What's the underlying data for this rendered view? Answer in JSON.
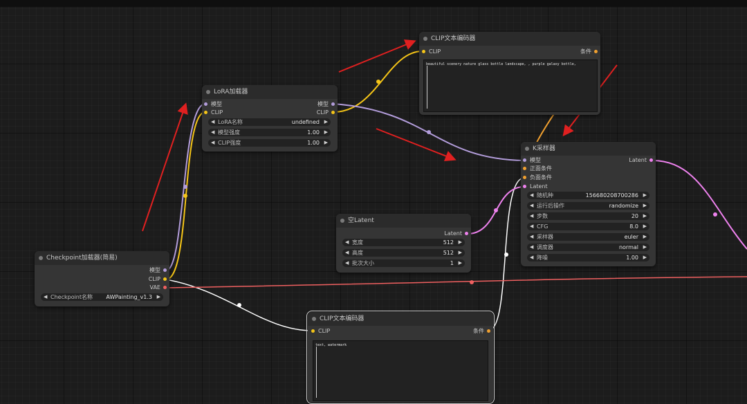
{
  "colors": {
    "model": "#b39ddb",
    "clip": "#f5c518",
    "vae": "#f06060",
    "cond": "#f0a030",
    "latent": "#ee82ee",
    "white": "#ffffff",
    "arrow": "#e02020"
  },
  "nodes": {
    "clip_top": {
      "title": "CLIP文本编码器",
      "in_clip": "CLIP",
      "out_cond": "条件",
      "text": "beautiful scenery nature glass bottle landscape, , purple galaxy bottle,"
    },
    "lora": {
      "title": "LoRA加载器",
      "in_model": "模型",
      "in_clip": "CLIP",
      "out_model": "模型",
      "out_clip": "CLIP",
      "widgets": [
        {
          "label": "LoRA名称",
          "value": "undefined"
        },
        {
          "label": "模型强度",
          "value": "1.00"
        },
        {
          "label": "CLIP强度",
          "value": "1.00"
        }
      ]
    },
    "ksampler": {
      "title": "K采样器",
      "in_model": "模型",
      "in_pos": "正面条件",
      "in_neg": "负面条件",
      "in_latent": "Latent",
      "out_latent": "Latent",
      "widgets": [
        {
          "label": "随机种",
          "value": "156680208700286"
        },
        {
          "label": "运行后操作",
          "value": "randomize"
        },
        {
          "label": "步数",
          "value": "20"
        },
        {
          "label": "CFG",
          "value": "8.0"
        },
        {
          "label": "采样器",
          "value": "euler"
        },
        {
          "label": "调度器",
          "value": "normal"
        },
        {
          "label": "降噪",
          "value": "1.00"
        }
      ]
    },
    "empty_latent": {
      "title": "空Latent",
      "out_latent": "Latent",
      "widgets": [
        {
          "label": "宽度",
          "value": "512"
        },
        {
          "label": "高度",
          "value": "512"
        },
        {
          "label": "批次大小",
          "value": "1"
        }
      ]
    },
    "checkpoint": {
      "title": "Checkpoint加载器(简易)",
      "out_model": "模型",
      "out_clip": "CLIP",
      "out_vae": "VAE",
      "widgets": [
        {
          "label": "Checkpoint名称",
          "value": "AWPainting_v1.3"
        }
      ]
    },
    "clip_bottom": {
      "title": "CLIP文本编码器",
      "in_clip": "CLIP",
      "out_cond": "条件",
      "text": "text, watermark"
    }
  }
}
